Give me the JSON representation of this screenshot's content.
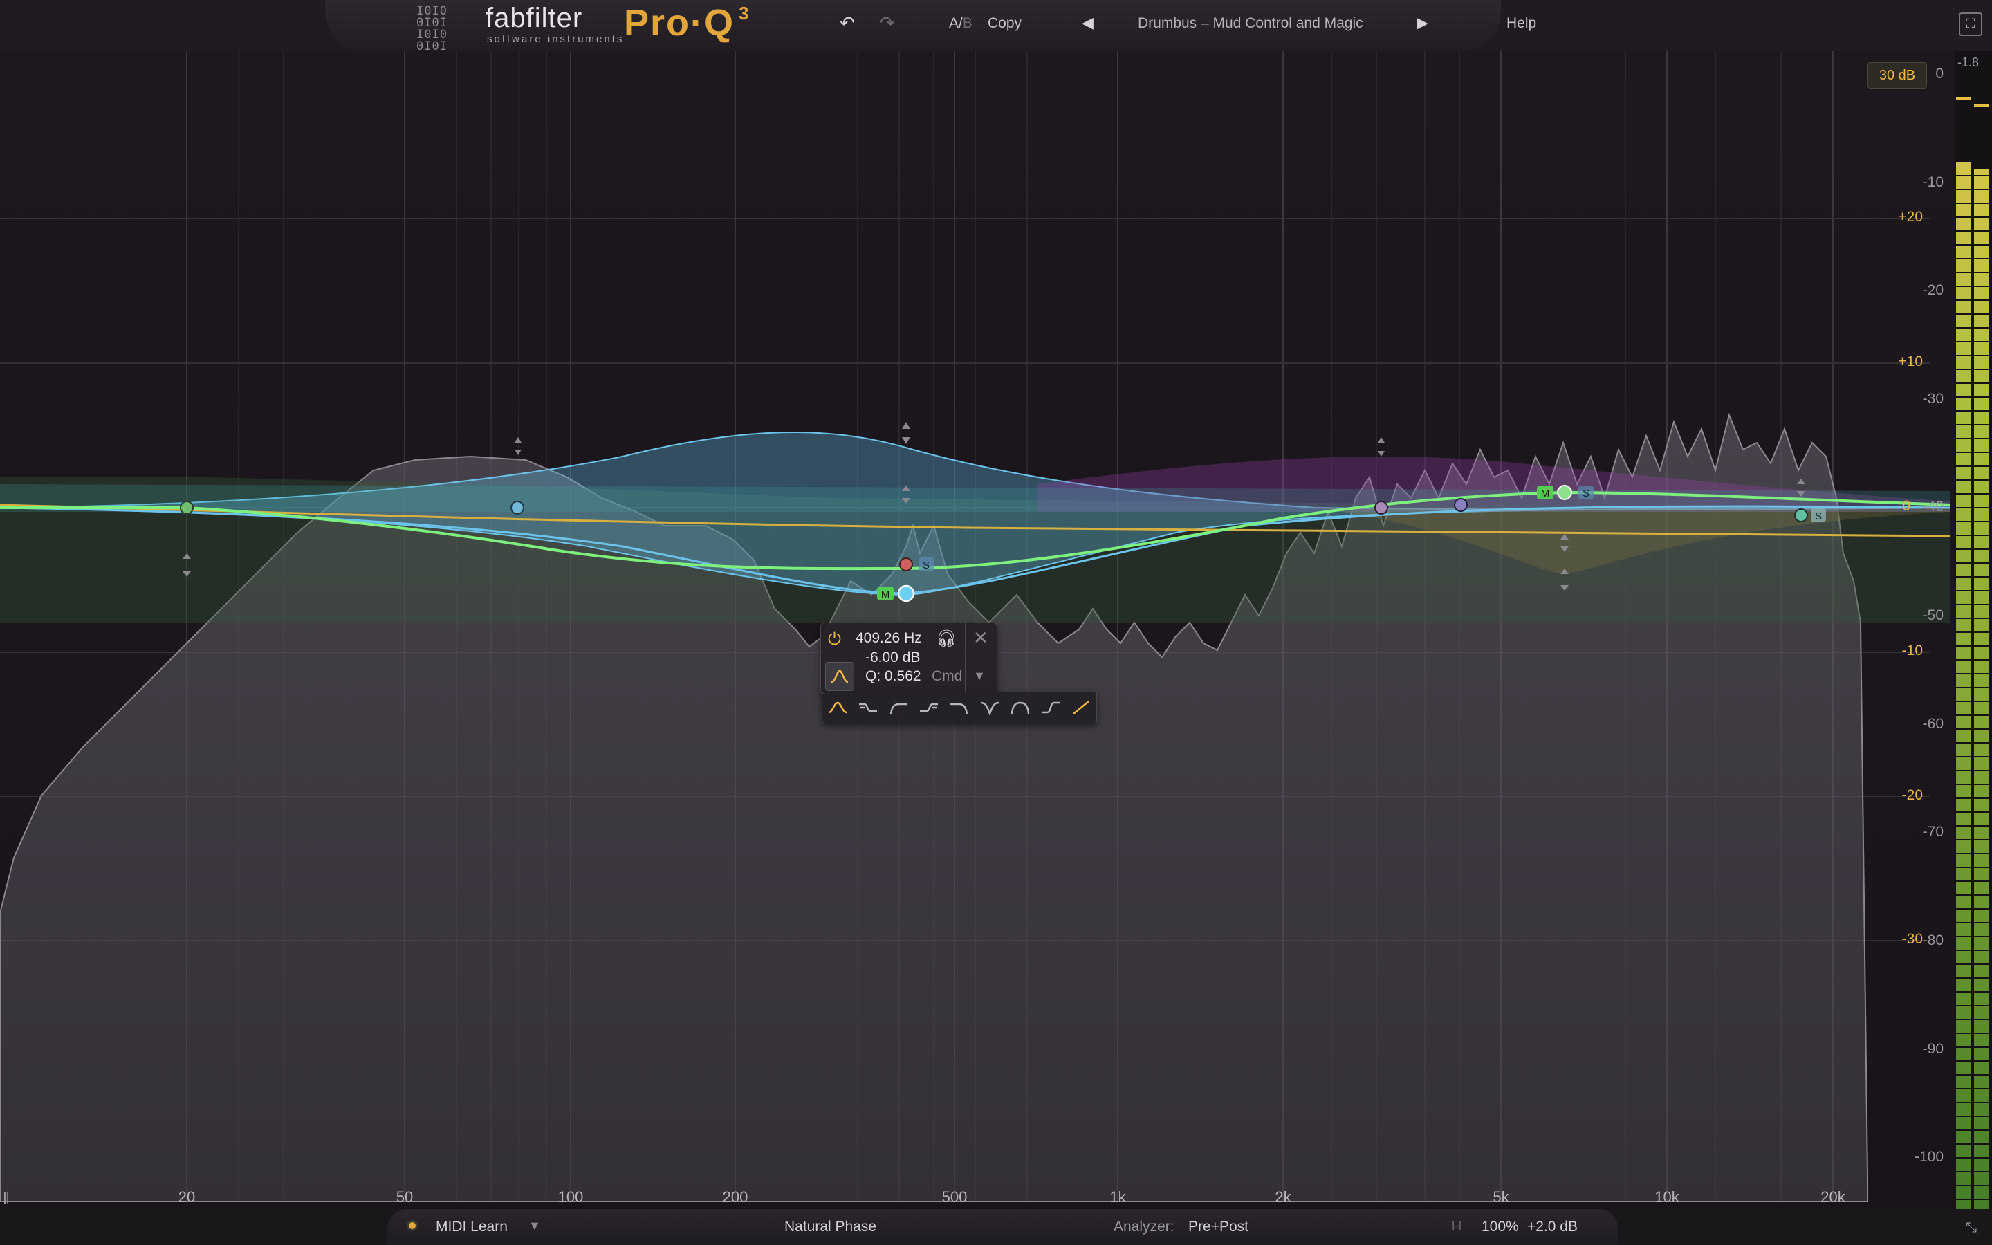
{
  "header": {
    "brand": "fabfilter",
    "brand_sub": "software instruments",
    "product": "Pro·Q",
    "product_version": "3",
    "ab_a": "A/",
    "ab_b": "B",
    "copy_label": "Copy",
    "preset_name": "Drumbus – Mud Control and Magic",
    "help_label": "Help"
  },
  "display": {
    "range_badge": "30 dB",
    "gain_scale": [
      "+20",
      "+10",
      "0",
      "-10",
      "-20",
      "-30"
    ],
    "spectrum_scale": [
      "0",
      "-10",
      "-20",
      "-30",
      "-40",
      "-50",
      "-60",
      "-70",
      "-80",
      "-90",
      "-100"
    ],
    "freq_labels": [
      "20",
      "50",
      "100",
      "200",
      "500",
      "1k",
      "2k",
      "5k",
      "10k",
      "20k"
    ],
    "meter_peak": "-1.8"
  },
  "band_popup": {
    "frequency": "409.26 Hz",
    "gain": "-6.00 dB",
    "q": "Q: 0.562",
    "q_modifier": "Cmd"
  },
  "band_markers": {
    "mid": "M",
    "side": "S"
  },
  "bottom_bar": {
    "midi_learn": "MIDI Learn",
    "phase_mode": "Natural Phase",
    "analyzer_label": "Analyzer:",
    "analyzer_value": "Pre+Post",
    "output_scale": "100%",
    "output_gain": "+2.0 dB"
  },
  "colors": {
    "accent": "#e3a63a",
    "eq_curve": "#7df07d",
    "band_blue": "#5fb8e0",
    "band_magenta": "#b050c0",
    "band_yellow": "#d8b040",
    "meter_green": "#7ec83a"
  }
}
